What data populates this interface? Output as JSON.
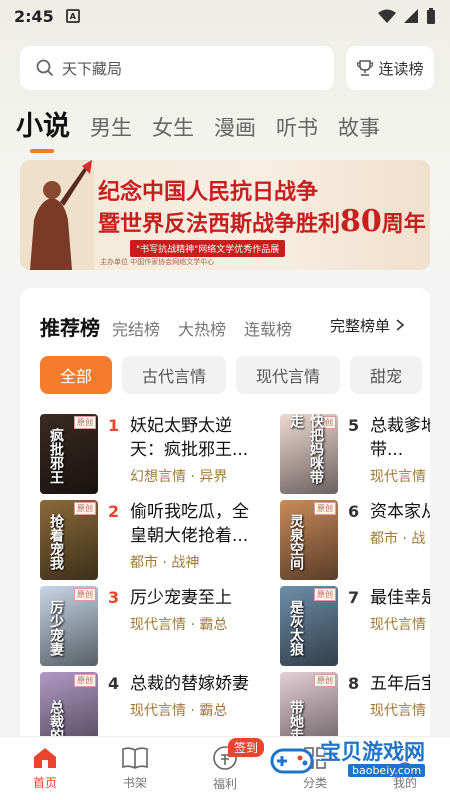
{
  "status": {
    "time": "2:45",
    "sim": "A"
  },
  "search": {
    "placeholder": "天下藏局",
    "rank_label": "连读榜"
  },
  "tabs": [
    "小说",
    "男生",
    "女生",
    "漫画",
    "听书",
    "故事"
  ],
  "banner": {
    "line1": "纪念中国人民抗日战争",
    "line2": "暨世界反法西斯战争胜利",
    "num": "80",
    "line2_suffix": "周年",
    "tag": "\"书写抗战精神\"网络文学优秀作品展",
    "orgs": "主办单位  中国作家协会网络文学中心"
  },
  "ranking": {
    "title": "推荐榜",
    "subs": [
      "完结榜",
      "大热榜",
      "连载榜"
    ],
    "full": "完整榜单",
    "chips": [
      "全部",
      "古代言情",
      "现代言情",
      "甜宠"
    ]
  },
  "books": [
    {
      "rank": "1",
      "name": "妖妃太野太逆天：疯批邪王...",
      "genre": "幻想言情 · 异界",
      "cover_text": "疯批邪王",
      "cover_color": "#3a2a22"
    },
    {
      "rank": "2",
      "name": "偷听我吃瓜，全皇朝大佬抢着...",
      "genre": "都市 · 战神",
      "cover_text": "抢着宠我",
      "cover_color": "#8a6a3a"
    },
    {
      "rank": "3",
      "name": "厉少宠妻至上",
      "genre": "现代言情 · 霸总",
      "cover_text": "厉少宠妻",
      "cover_color": "#c7d6e6"
    },
    {
      "rank": "4",
      "name": "总裁的替嫁娇妻",
      "genre": "现代言情 · 霸总",
      "cover_text": "总裁的",
      "cover_color": "#b09ac4"
    },
    {
      "rank": "5",
      "name": "总裁爹地妈咪带...",
      "genre": "现代言情",
      "cover_text": "快把妈咪带走",
      "cover_color": "#efd9d2"
    },
    {
      "rank": "6",
      "name": "资本家从军，...",
      "genre": "都市 · 战",
      "cover_text": "灵泉空间",
      "cover_color": "#c98a5a"
    },
    {
      "rank": "7",
      "name": "最佳幸是灰太...",
      "genre": "现代言情",
      "cover_text": "是灰太狼",
      "cover_color": "#6e8ea8"
    },
    {
      "rank": "8",
      "name": "五年后宝带她...",
      "genre": "现代言情",
      "cover_text": "带她走",
      "cover_color": "#e4cfd6"
    }
  ],
  "tabbar": [
    "首页",
    "书架",
    "福利",
    "分类",
    "我的"
  ],
  "sign_badge": "签到",
  "watermark": {
    "big": "宝贝游戏网",
    "small": "baobeiy.com"
  }
}
